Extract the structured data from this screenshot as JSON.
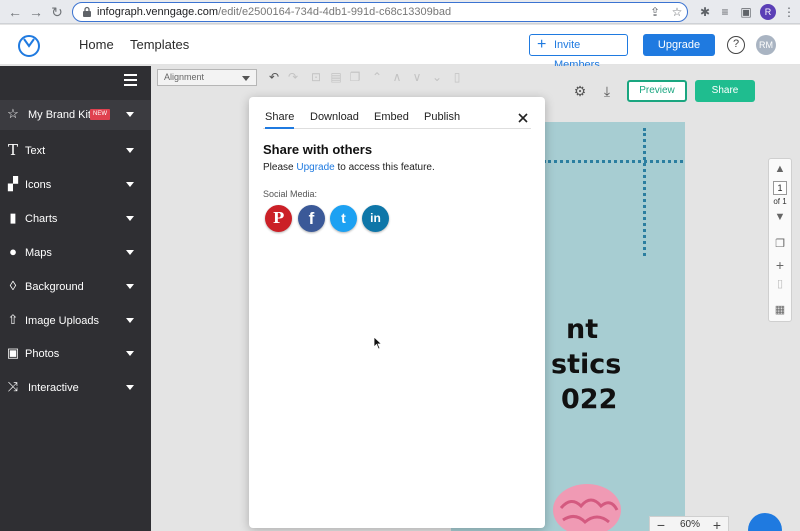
{
  "browser": {
    "url_host": "infograph.venngage.com",
    "url_path": "/edit/e2500164-734d-4db1-991d-c68c13309bad",
    "profile_initial": "R"
  },
  "header": {
    "nav": [
      "Home",
      "Templates"
    ],
    "invite_label": "Invite Members",
    "upgrade_label": "Upgrade",
    "help_label": "?",
    "avatar_initials": "RM"
  },
  "sidebar": {
    "items": [
      {
        "label": "My Brand Kit",
        "icon": "star-icon",
        "badge": "NEW"
      },
      {
        "label": "Text",
        "icon": "text-icon"
      },
      {
        "label": "Icons",
        "icon": "shapes-icon"
      },
      {
        "label": "Charts",
        "icon": "bar-chart-icon"
      },
      {
        "label": "Maps",
        "icon": "globe-icon"
      },
      {
        "label": "Background",
        "icon": "fill-icon"
      },
      {
        "label": "Image Uploads",
        "icon": "upload-icon"
      },
      {
        "label": "Photos",
        "icon": "photo-icon"
      },
      {
        "label": "Interactive",
        "icon": "shuffle-icon"
      }
    ]
  },
  "toolbar": {
    "alignment_label": "Alignment",
    "preview_label": "Preview",
    "share_label": "Share"
  },
  "canvas": {
    "title_lines": [
      "nt",
      "stics",
      "022"
    ],
    "page_number": "1",
    "page_of": "of 1",
    "zoom": "60%"
  },
  "modal": {
    "tabs": [
      "Share",
      "Download",
      "Embed",
      "Publish"
    ],
    "active_tab": "Share",
    "heading": "Share with others",
    "text_before": "Please ",
    "link": "Upgrade",
    "text_after": " to access this feature.",
    "social_label": "Social Media:",
    "social": [
      {
        "name": "pinterest",
        "glyph": "P",
        "color": "#cb2027"
      },
      {
        "name": "facebook",
        "glyph": "f",
        "color": "#3b5998"
      },
      {
        "name": "twitter",
        "glyph": "t",
        "color": "#1da1f2"
      },
      {
        "name": "linkedin",
        "glyph": "in",
        "color": "#0e76a8"
      }
    ]
  },
  "colors": {
    "accent": "#1f7ae0",
    "share_green": "#1fbd8f",
    "sidebar_bg": "#2f2f33",
    "page_bg": "#a7cdd2"
  }
}
